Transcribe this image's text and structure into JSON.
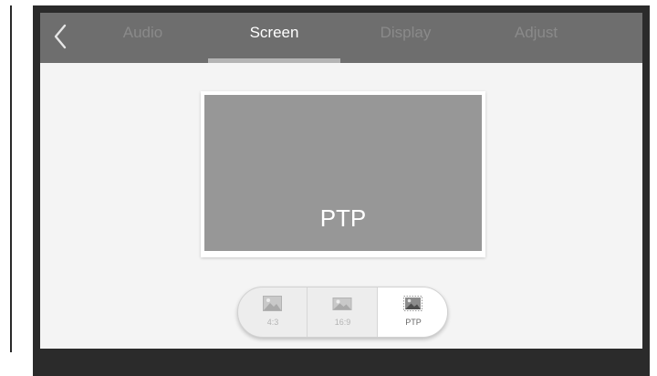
{
  "tabs": [
    {
      "label": "Audio",
      "active": false
    },
    {
      "label": "Screen",
      "active": true
    },
    {
      "label": "Display",
      "active": false
    },
    {
      "label": "Adjust",
      "active": false
    }
  ],
  "preview": {
    "label": "PTP"
  },
  "aspect_ratio": {
    "selected": "PTP",
    "options": [
      {
        "label": "4:3",
        "icon": "image-icon"
      },
      {
        "label": "16:9",
        "icon": "image-icon"
      },
      {
        "label": "PTP",
        "icon": "image-fit-icon"
      }
    ]
  },
  "icons": {
    "back": "chevron-left-icon"
  },
  "colors": {
    "top_bar": "#6e6e6e",
    "active_tab": "#ffffff",
    "inactive_tab": "#8a8a8a",
    "preview_fill": "#979797",
    "screen_bg": "#f4f4f4"
  }
}
